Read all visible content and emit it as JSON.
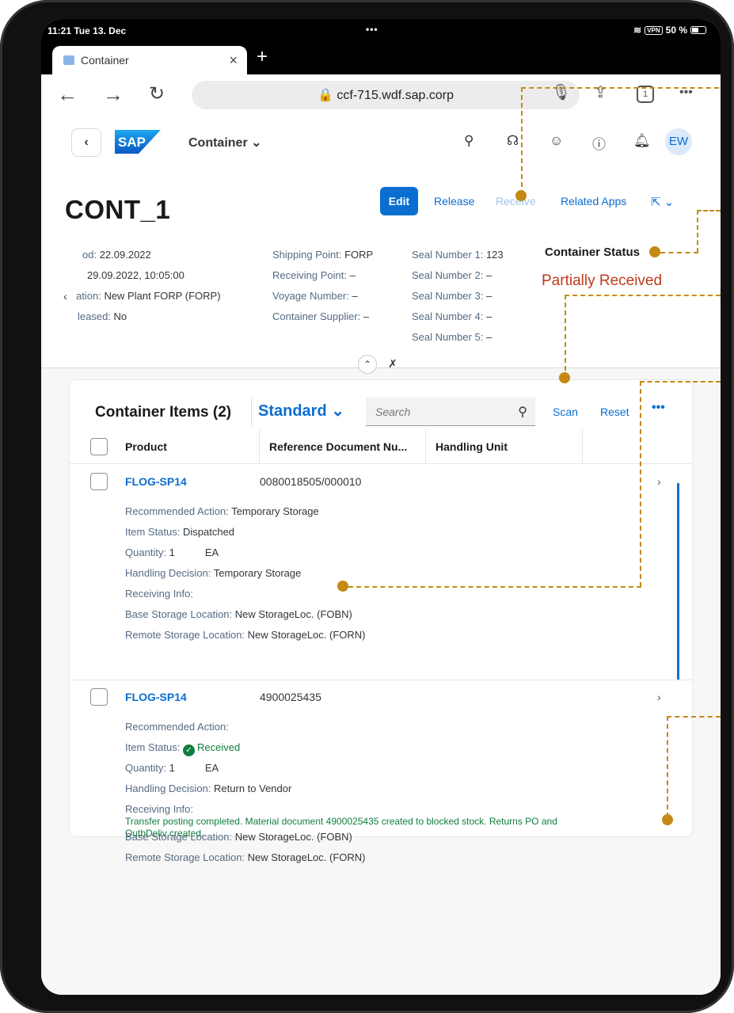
{
  "status_bar": {
    "time": "11:21  Tue 13. Dec",
    "dots": "•••",
    "vpn": "VPN",
    "battery": "50 %"
  },
  "browser": {
    "tab_title": "Container",
    "tab_close": "×",
    "new_tab": "+",
    "url": "🔒 ccf-715.wdf.sap.corp",
    "tab_count": "1",
    "menu": "•••"
  },
  "shell": {
    "back": "‹",
    "logo": "SAP",
    "app_title": "Container ⌄",
    "avatar": "EW"
  },
  "object": {
    "title": "CONT_1",
    "actions": {
      "edit": "Edit",
      "release": "Release",
      "receive": "Receive",
      "related": "Related Apps"
    }
  },
  "attributes": {
    "col1": [
      {
        "label": "od:",
        "value": "22.09.2022"
      },
      {
        "label": "",
        "value": "29.09.2022, 10:05:00"
      },
      {
        "label": "ation:",
        "value": "New Plant FORP (FORP)"
      },
      {
        "label": "leased:",
        "value": "No"
      }
    ],
    "col2": [
      {
        "label": "Shipping Point:",
        "value": "FORP"
      },
      {
        "label": "Receiving Point:",
        "value": "–"
      },
      {
        "label": "Voyage Number:",
        "value": "–"
      },
      {
        "label": "Container Supplier:",
        "value": "–"
      }
    ],
    "col3": [
      {
        "label": "Seal Number 1:",
        "value": "123"
      },
      {
        "label": "Seal Number 2:",
        "value": "–"
      },
      {
        "label": "Seal Number 3:",
        "value": "–"
      },
      {
        "label": "Seal Number 4:",
        "value": "–"
      },
      {
        "label": "Seal Number 5:",
        "value": "–"
      }
    ],
    "status_label": "Container Status",
    "status_value": "Partially Received",
    "status_color": "#bb3b1e"
  },
  "table": {
    "title": "Container Items (2)",
    "variant": "Standard  ⌄",
    "search_placeholder": "Search",
    "scan": "Scan",
    "reset": "Reset",
    "more": "•••",
    "columns": [
      "Product",
      "Reference Document Nu...",
      "Handling Unit"
    ],
    "rows": [
      {
        "product": "FLOG-SP14",
        "reference": "0080018505/000010",
        "recommended_label": "Recommended Action:",
        "recommended": "Temporary Storage",
        "status_label": "Item Status:",
        "status": "Dispatched",
        "quantity_label": "Quantity:",
        "quantity": "1",
        "unit": "EA",
        "handling_label": "Handling Decision:",
        "handling": "Temporary Storage",
        "receiving_label": "Receiving Info:",
        "receiving": "",
        "base_label": "Base Storage Location:",
        "base": "New StorageLoc. (FOBN)",
        "remote_label": "Remote Storage Location:",
        "remote": "New StorageLoc. (FORN)"
      },
      {
        "product": "FLOG-SP14",
        "reference": "4900025435",
        "recommended_label": "Recommended Action:",
        "recommended": "",
        "status_label": "Item Status:",
        "status": "Received",
        "quantity_label": "Quantity:",
        "quantity": "1",
        "unit": "EA",
        "handling_label": "Handling Decision:",
        "handling": "Return to Vendor",
        "receiving_label": "Receiving Info:",
        "receiving_line1": "Transfer posting completed. Material document 4900025435 created to blocked stock. Returns PO and",
        "receiving_line2": "OutbDeliv created.",
        "base_label": "Base Storage Location:",
        "base": "New StorageLoc. (FOBN)",
        "remote_label": "Remote Storage Location:",
        "remote": "New StorageLoc. (FORN)"
      }
    ]
  },
  "colors": {
    "accent": "#0a6ed1",
    "annotation": "#c48a15",
    "success": "#107e3e"
  }
}
